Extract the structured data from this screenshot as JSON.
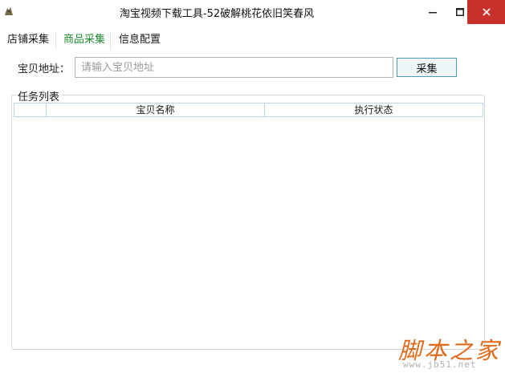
{
  "window": {
    "title": "淘宝视频下载工具-52破解桃花依旧笑春风",
    "minimize_icon": "minimize-icon",
    "maximize_icon": "maximize-icon",
    "close_icon": "close-icon"
  },
  "menu": {
    "items": [
      {
        "label": "店铺采集",
        "active": false
      },
      {
        "label": "商品采集",
        "active": true
      },
      {
        "label": "信息配置",
        "active": false
      }
    ],
    "active_color": "#1e8c2e"
  },
  "form": {
    "address_label": "宝贝地址：",
    "address_placeholder": "请输入宝贝地址",
    "address_value": "",
    "collect_button": "采集"
  },
  "task_list": {
    "legend": "任务列表",
    "columns": [
      "",
      "宝贝名称",
      "执行状态"
    ],
    "rows": []
  },
  "watermark": {
    "text": "脚本之家",
    "url": "www.jb51.net"
  }
}
